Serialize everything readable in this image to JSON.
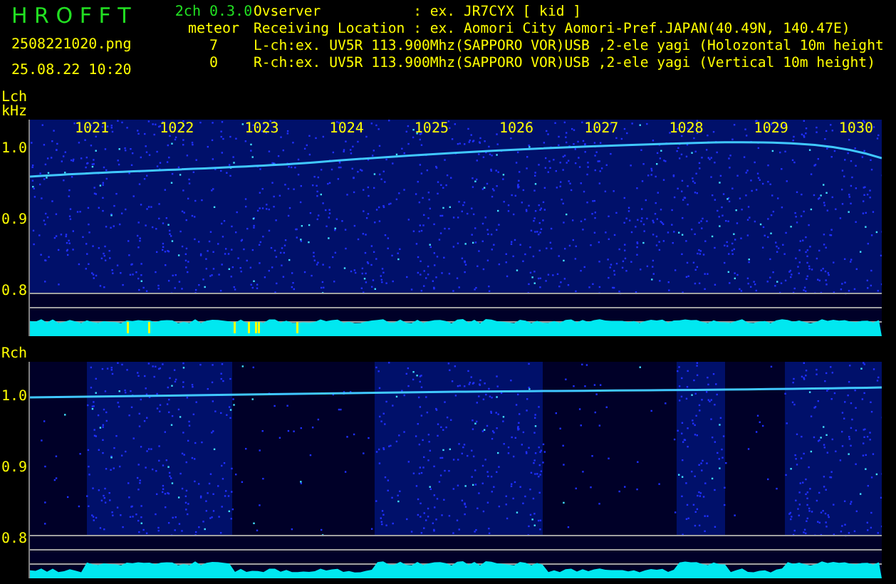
{
  "header": {
    "title": "H R O F F T",
    "version": "2ch 0.3.0",
    "filename": "2508221020.png",
    "datetime": "25.08.22 10:20",
    "meteor_label": "meteor",
    "meteor_counts": [
      "7",
      "0"
    ],
    "info_lines": [
      "Ovserver           : ex. JR7CYX [ kid ]",
      "Receiving Location : ex. Aomori City Aomori-Pref.JAPAN(40.49N, 140.47E)",
      "L-ch:ex. UV5R 113.900Mhz(SAPPORO VOR)USB ,2-ele yagi (Holozontal 10m height",
      "R-ch:ex. UV5R 113.900Mhz(SAPPORO VOR)USB ,2-ele yagi (Vertical 10m height)"
    ]
  },
  "panels": [
    {
      "label": "Lch",
      "unit": "kHz",
      "time_ticks": [
        "1021",
        "1022",
        "1023",
        "1024",
        "1025",
        "1026",
        "1027",
        "1028",
        "1029",
        "1030"
      ],
      "y_labels": [
        "1.0",
        "0.9",
        "0.8"
      ]
    },
    {
      "label": "Rch",
      "y_labels": [
        "1.0",
        "0.9",
        "0.8"
      ]
    }
  ]
}
